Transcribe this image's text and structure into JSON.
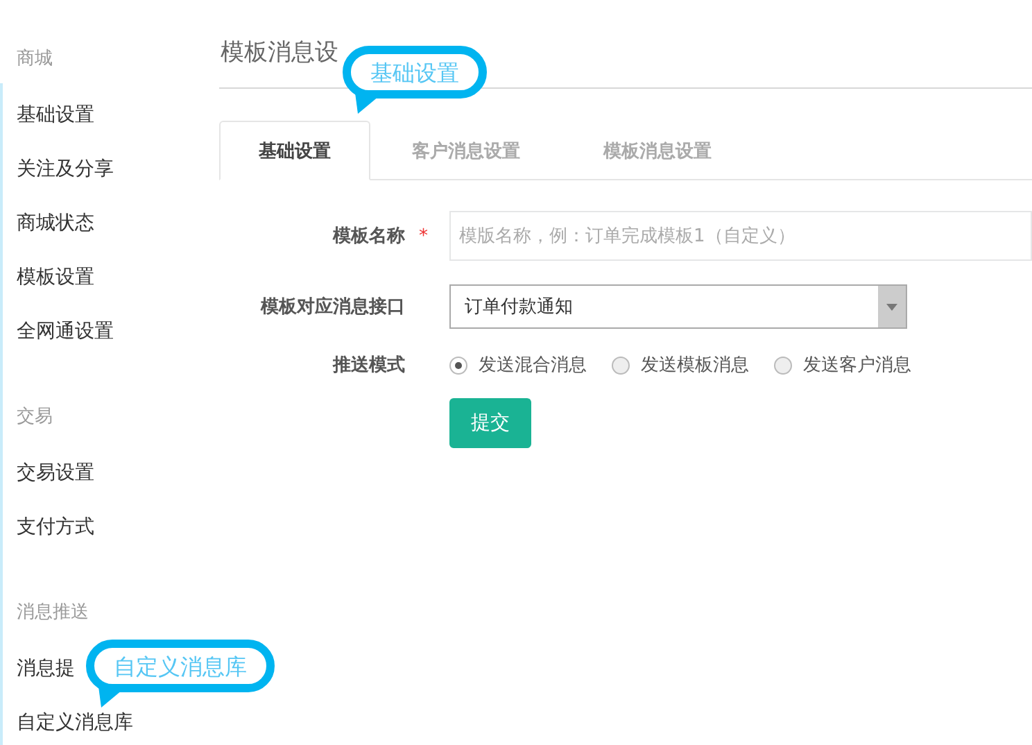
{
  "sidebar": {
    "sections": [
      {
        "heading": "商城",
        "items": [
          "基础设置",
          "关注及分享",
          "商城状态",
          "模板设置",
          "全网通设置"
        ]
      },
      {
        "heading": "交易",
        "items": [
          "交易设置",
          "支付方式"
        ]
      },
      {
        "heading": "消息推送",
        "items": [
          "消息提",
          "自定义消息库"
        ]
      }
    ]
  },
  "page_title": "模板消息设",
  "tabs": [
    {
      "label": "基础设置",
      "selected": true
    },
    {
      "label": "客户消息设置",
      "selected": false
    },
    {
      "label": "模板消息设置",
      "selected": false
    }
  ],
  "form": {
    "name_field": {
      "label": "模板名称",
      "required": true,
      "required_mark": "*",
      "placeholder": "模版名称，例：订单完成模板1（自定义）"
    },
    "interface_select": {
      "label": "模板对应消息接口",
      "value": "订单付款通知"
    },
    "push_mode": {
      "label": "推送模式",
      "options": [
        {
          "label": "发送混合消息",
          "selected": true
        },
        {
          "label": "发送模板消息",
          "selected": false
        },
        {
          "label": "发送客户消息",
          "selected": false
        }
      ]
    },
    "submit": "提交"
  },
  "callouts": [
    {
      "text": "基础设置"
    },
    {
      "text": "自定义消息库"
    }
  ]
}
